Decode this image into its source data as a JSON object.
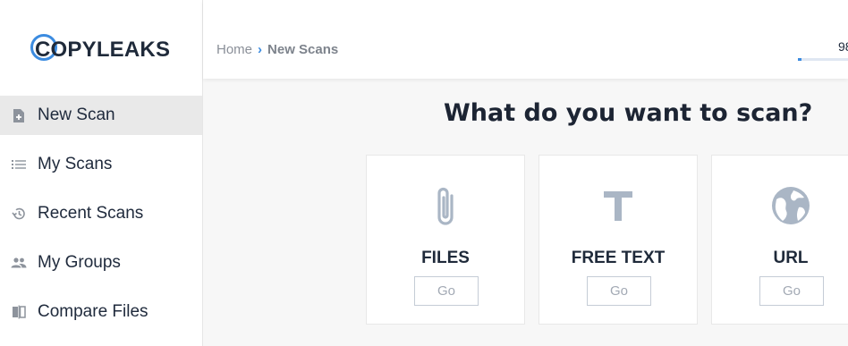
{
  "brand": {
    "name": "COPYLEAKS",
    "accent": "#3b8be0"
  },
  "sidebar": {
    "items": [
      {
        "label": "New Scan",
        "icon": "new-file-icon",
        "active": true
      },
      {
        "label": "My Scans",
        "icon": "list-icon",
        "active": false
      },
      {
        "label": "Recent Scans",
        "icon": "history-icon",
        "active": false
      },
      {
        "label": "My Groups",
        "icon": "people-icon",
        "active": false
      },
      {
        "label": "Compare Files",
        "icon": "compare-icon",
        "active": false
      }
    ]
  },
  "header": {
    "breadcrumb": {
      "home": "Home",
      "current": "New Scans"
    },
    "credits_text": "98",
    "credits_progress_fraction": 0.08
  },
  "main": {
    "heading": "What do you want to scan?",
    "cards": [
      {
        "title": "FILES",
        "icon": "paperclip-icon",
        "button_label": "Go"
      },
      {
        "title": "FREE TEXT",
        "icon": "text-t-icon",
        "button_label": "Go"
      },
      {
        "title": "URL",
        "icon": "globe-icon",
        "button_label": "Go"
      }
    ]
  }
}
